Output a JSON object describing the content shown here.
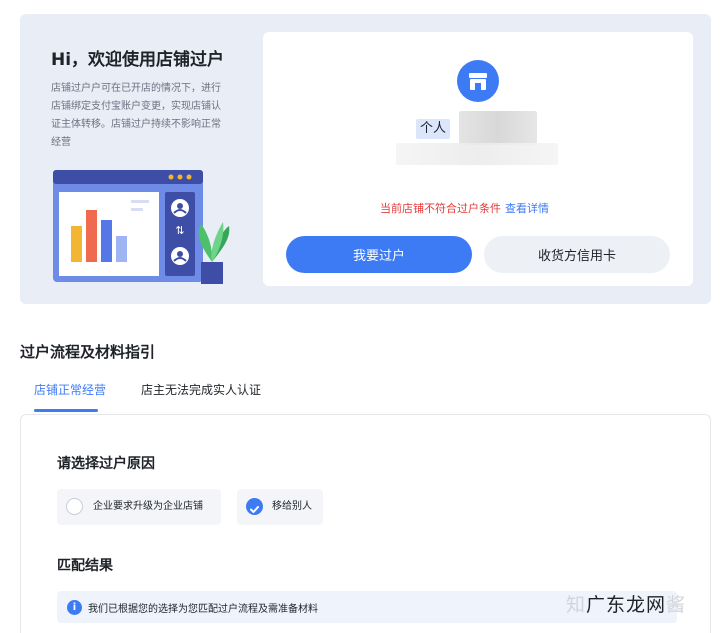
{
  "hero": {
    "title": "Hi，欢迎使用店铺过户",
    "description": "店铺过户户可在已开店的情况下，进行店铺绑定支付宝账户变更，实现店铺认证主体转移。店铺过户持续不影响正常经营"
  },
  "card": {
    "person_tag": "个人",
    "warning": "当前店铺不符合过户条件",
    "detail_link": "查看详情",
    "primary_button": "我要过户",
    "secondary_button": "收货方信用卡"
  },
  "guide": {
    "title": "过户流程及材料指引",
    "tabs": [
      {
        "label": "店铺正常经营",
        "active": true
      },
      {
        "label": "店主无法完成实人认证",
        "active": false
      }
    ]
  },
  "panel": {
    "reason_heading": "请选择过户原因",
    "options": [
      {
        "label": "企业要求升级为企业店铺",
        "checked": false
      },
      {
        "label": "移给别人",
        "checked": true
      }
    ],
    "result_heading": "匹配结果",
    "info_icon_glyph": "i",
    "info_text": "我们已根据您的选择为您匹配过户流程及需准备材料"
  },
  "watermark": {
    "prefix": "知",
    "main": "广东龙网",
    "suffix": "酱"
  },
  "colors": {
    "accent": "#3d7bf5",
    "warning": "#e23b3b",
    "hero_bg": "#e9edf6"
  }
}
